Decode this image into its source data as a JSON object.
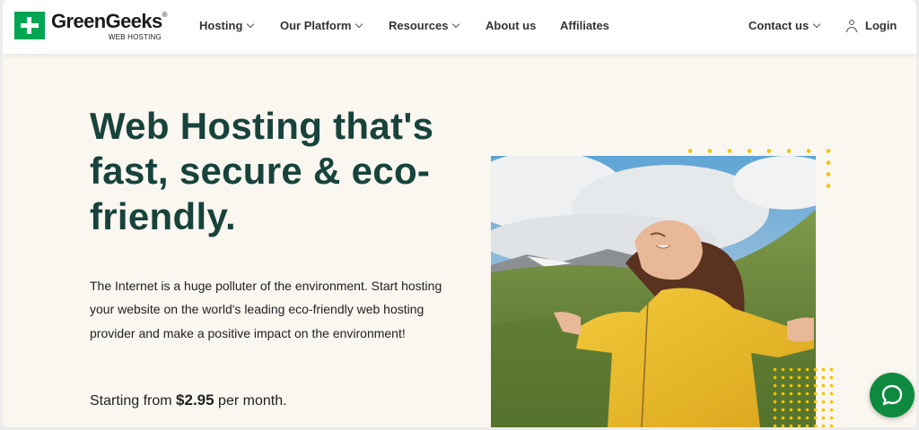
{
  "logo": {
    "name": "GreenGeeks",
    "trademark": "®",
    "tagline": "WEB HOSTING",
    "brand_color": "#00a651"
  },
  "nav": {
    "items": [
      {
        "label": "Hosting",
        "has_dropdown": true
      },
      {
        "label": "Our Platform",
        "has_dropdown": true
      },
      {
        "label": "Resources",
        "has_dropdown": true
      },
      {
        "label": "About us",
        "has_dropdown": false
      },
      {
        "label": "Affiliates",
        "has_dropdown": false
      }
    ],
    "contact": {
      "label": "Contact us",
      "has_dropdown": true
    },
    "login": {
      "label": "Login",
      "icon": "user-icon"
    }
  },
  "hero": {
    "title": "Web Hosting that's fast, secure & eco-friendly.",
    "description": "The Internet is a huge polluter of the environment. Start hosting your website on the world's leading eco-friendly web hosting provider and make a positive impact on the environment!",
    "price_prefix": "Starting from",
    "price": "$2.95",
    "price_suffix": "per month.",
    "title_color": "#17433b"
  },
  "image": {
    "subject": "woman in yellow jacket with arms outstretched in green mountain meadow",
    "accent_dots_color": "#f2c200"
  },
  "chat": {
    "icon": "chat-bubble-icon",
    "color": "#0e8a3e"
  }
}
